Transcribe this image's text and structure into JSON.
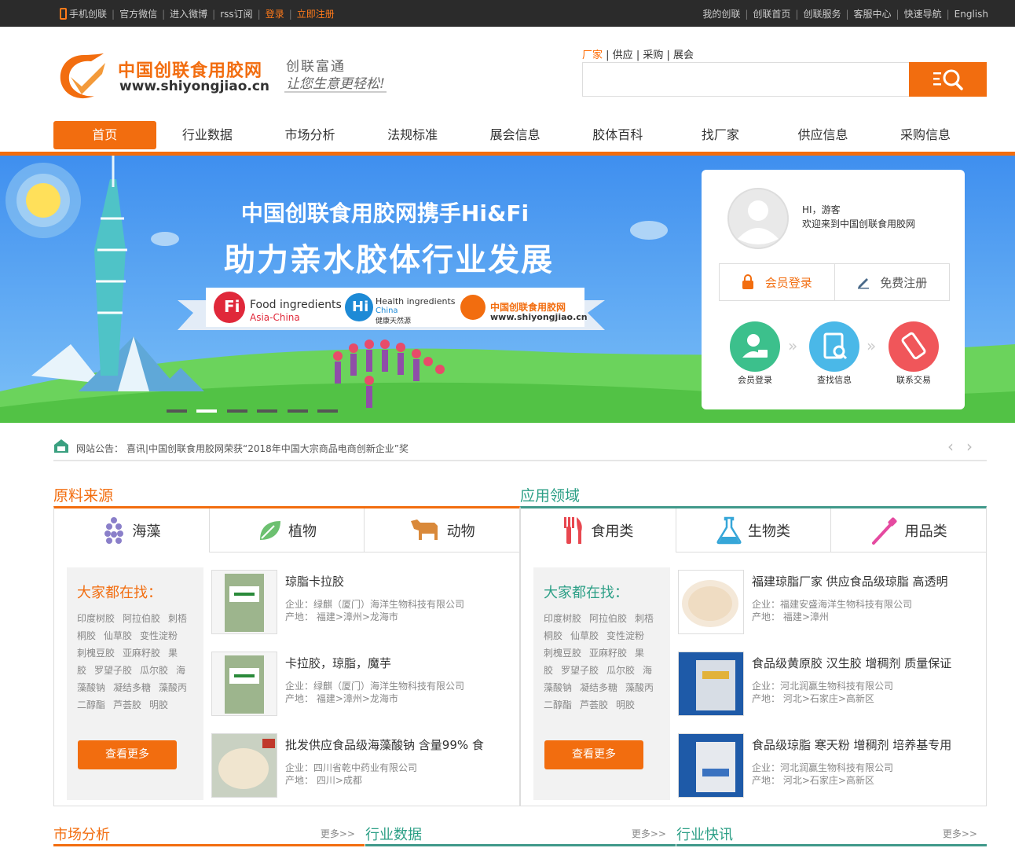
{
  "topbar": {
    "left": [
      "手机创联",
      "官方微信",
      "进入微博",
      "rss订阅",
      "登录",
      "立即注册"
    ],
    "right": [
      "我的创联",
      "创联首页",
      "创联服务",
      "客服中心",
      "快速导航",
      "English"
    ]
  },
  "logo": {
    "title": "中国创联食用胶网",
    "url": "www.shiyongjiao.cn",
    "slogan1": "创联富通",
    "slogan2": "让您生意更轻松!"
  },
  "search": {
    "tabs": [
      "厂家",
      "供应",
      "采购",
      "展会"
    ],
    "placeholder": ""
  },
  "nav": [
    "首页",
    "行业数据",
    "市场分析",
    "法规标准",
    "展会信息",
    "胶体百科",
    "找厂家",
    "供应信息",
    "采购信息"
  ],
  "banner": {
    "line1": "中国创联食用胶网携手Hi&Fi",
    "line2": "助力亲水胶体行业发展",
    "fi_title": "Food ingredients",
    "fi_sub": "Asia-China",
    "hi_title": "Health ingredients",
    "hi_sub1": "China",
    "hi_sub2": "健康天然源",
    "brand_name": "中国创联食用胶网",
    "brand_url": "www.shiyongjiao.cn"
  },
  "user": {
    "greeting": "HI，游客",
    "welcome": "欢迎来到中国创联食用胶网",
    "login": "会员登录",
    "register": "免费注册",
    "steps": [
      "会员登录",
      "查找信息",
      "联系交易"
    ]
  },
  "notice": {
    "label": "网站公告：",
    "text": "喜讯|中国创联食用胶网荣获“2018年中国大宗商品电商创新企业”奖"
  },
  "raw": {
    "title": "原料来源",
    "tabs": [
      "海藻",
      "植物",
      "动物"
    ],
    "find_title": "大家都在找：",
    "tags": [
      "印度树胶",
      "阿拉伯胶",
      "刺梧桐胶",
      "仙草胶",
      "变性淀粉",
      "刺槐豆胶",
      "亚麻籽胶",
      "果胶",
      "罗望子胶",
      "瓜尔胶",
      "海藻酸钠",
      "凝结多糖",
      "藻酸丙二醇酯",
      "芦荟胶",
      "明胶"
    ],
    "more": "查看更多",
    "products": [
      {
        "name": "琼脂卡拉胶",
        "company": "企业：绿麒（厦门）海洋生物科技有限公司",
        "origin": "产地： 福建>漳州>龙海市"
      },
      {
        "name": "卡拉胶，琼脂，魔芋",
        "company": "企业：绿麒（厦门）海洋生物科技有限公司",
        "origin": "产地： 福建>漳州>龙海市"
      },
      {
        "name": "批发供应食品级海藻酸钠 含量99% 食",
        "company": "企业：四川省乾中药业有限公司",
        "origin": "产地： 四川>成都"
      }
    ]
  },
  "app": {
    "title": "应用领域",
    "tabs": [
      "食用类",
      "生物类",
      "用品类"
    ],
    "find_title": "大家都在找：",
    "tags": [
      "印度树胶",
      "阿拉伯胶",
      "刺梧桐胶",
      "仙草胶",
      "变性淀粉",
      "刺槐豆胶",
      "亚麻籽胶",
      "果胶",
      "罗望子胶",
      "瓜尔胶",
      "海藻酸钠",
      "凝结多糖",
      "藻酸丙二醇酯",
      "芦荟胶",
      "明胶"
    ],
    "more": "查看更多",
    "products": [
      {
        "name": "福建琼脂厂家 供应食品级琼脂 高透明",
        "company": "企业：福建安盛海洋生物科技有限公司",
        "origin": "产地： 福建>漳州"
      },
      {
        "name": "食品级黄原胶 汉生胶 增稠剂 质量保证",
        "company": "企业：河北润赢生物科技有限公司",
        "origin": "产地： 河北>石家庄>高新区"
      },
      {
        "name": "食品级琼脂 寒天粉 增稠剂 培养基专用",
        "company": "企业：河北润赢生物科技有限公司",
        "origin": "产地： 河北>石家庄>高新区"
      }
    ]
  },
  "bottom": [
    {
      "title": "市场分析",
      "more": "更多>>"
    },
    {
      "title": "行业数据",
      "more": "更多>>"
    },
    {
      "title": "行业快讯",
      "more": "更多>>"
    }
  ],
  "colors": {
    "accent": "#f26d0f",
    "green": "#2c9f86",
    "banner_sky": "#5aa9f5"
  }
}
